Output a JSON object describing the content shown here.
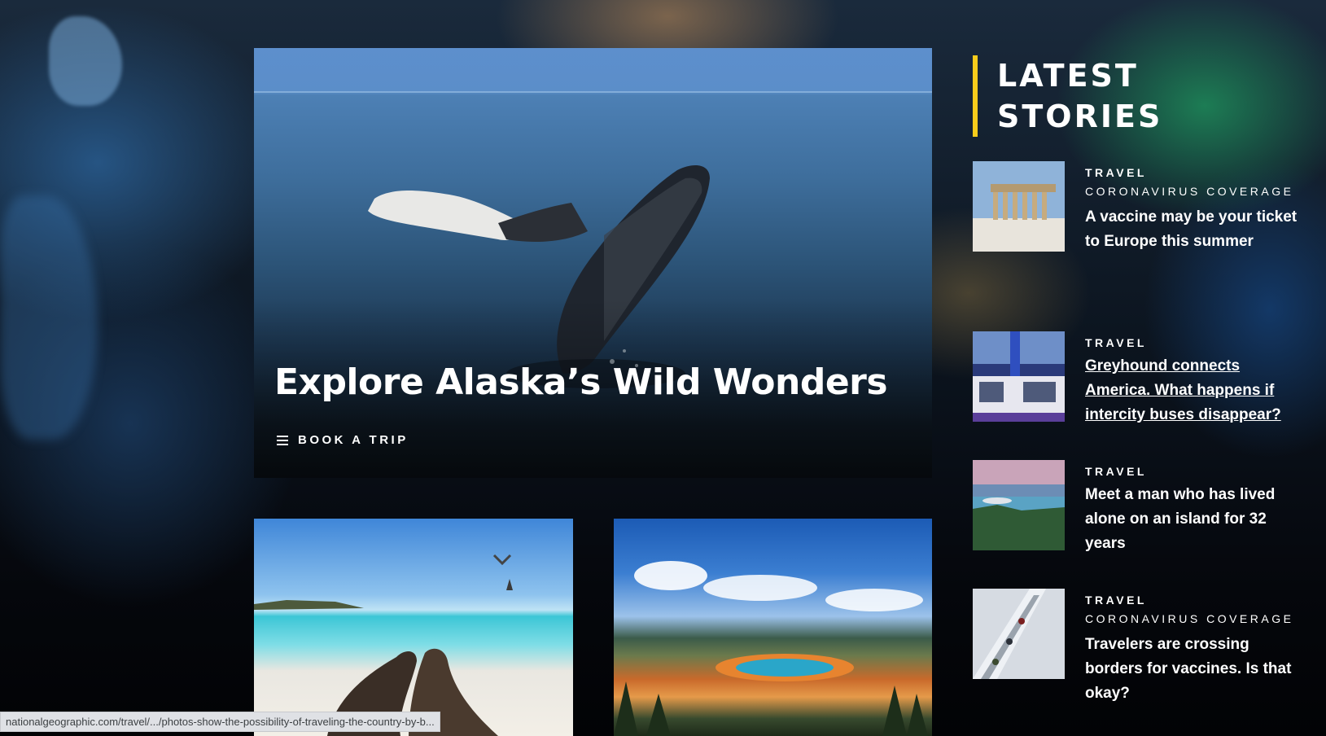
{
  "hero": {
    "title": "Explore Alaska’s Wild Wonders",
    "cta_label": "BOOK A TRIP",
    "cta_icon": "menu-icon"
  },
  "latest": {
    "heading": "LATEST STORIES",
    "stories": [
      {
        "kicker": "TRAVEL",
        "sub_kicker": "CORONAVIRUS COVERAGE",
        "headline": "A vaccine may be your ticket to Europe this summer"
      },
      {
        "kicker": "TRAVEL",
        "sub_kicker": "",
        "headline": "Greyhound connects America. What happens if intercity buses disappear?"
      },
      {
        "kicker": "TRAVEL",
        "sub_kicker": "",
        "headline": "Meet a man who has lived alone on an island for 32 years"
      },
      {
        "kicker": "TRAVEL",
        "sub_kicker": "CORONAVIRUS COVERAGE",
        "headline": "Travelers are crossing borders for vaccines. Is that okay?"
      }
    ]
  },
  "status_bar": {
    "url": "nationalgeographic.com/travel/.../photos-show-the-possibility-of-traveling-the-country-by-b..."
  },
  "colors": {
    "accent": "#f8cc1b",
    "text": "#ffffff",
    "background": "#05070c"
  }
}
